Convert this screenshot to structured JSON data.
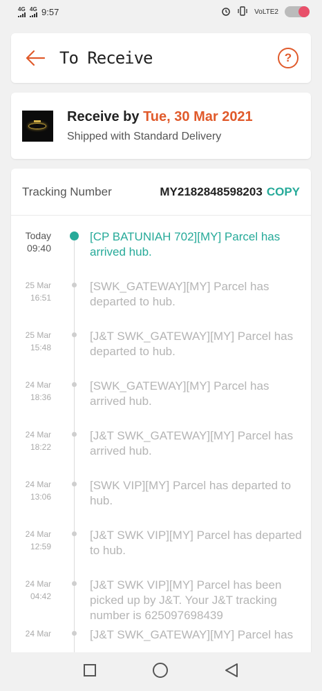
{
  "status_bar": {
    "network1": "4G",
    "network2": "4G",
    "time": "9:57",
    "volte": "VoLTE2"
  },
  "header": {
    "title": "To Receive",
    "help_icon": "question-circle-icon",
    "back_icon": "arrow-left-icon"
  },
  "delivery": {
    "receive_prefix": "Receive by",
    "receive_date": "Tue, 30 Mar 2021",
    "shipping_method": "Shipped with Standard Delivery"
  },
  "tracking": {
    "label": "Tracking Number",
    "number": "MY2182848598203",
    "copy_label": "COPY",
    "events": [
      {
        "date": "Today",
        "time": "09:40",
        "description": "[CP BATUNIAH 702][MY] Parcel has arrived hub.",
        "active": true
      },
      {
        "date": "25 Mar",
        "time": "16:51",
        "description": "[SWK_GATEWAY][MY] Parcel has departed to hub.",
        "active": false
      },
      {
        "date": "25 Mar",
        "time": "15:48",
        "description": "[J&T SWK_GATEWAY][MY] Parcel has departed to hub.",
        "active": false
      },
      {
        "date": "24 Mar",
        "time": "18:36",
        "description": "[SWK_GATEWAY][MY] Parcel has arrived hub.",
        "active": false
      },
      {
        "date": "24 Mar",
        "time": "18:22",
        "description": "[J&T SWK_GATEWAY][MY] Parcel has arrived hub.",
        "active": false
      },
      {
        "date": "24 Mar",
        "time": "13:06",
        "description": "[SWK VIP][MY] Parcel has departed to hub.",
        "active": false
      },
      {
        "date": "24 Mar",
        "time": "12:59",
        "description": "[J&T SWK VIP][MY] Parcel has departed to hub.",
        "active": false
      },
      {
        "date": "24 Mar",
        "time": "04:42",
        "description": "[J&T SWK VIP][MY] Parcel has been picked up by J&T. Your J&T tracking number is 625097698439",
        "active": false
      },
      {
        "date": "24 Mar",
        "time": "",
        "description": "[J&T SWK_GATEWAY][MY] Parcel has",
        "active": false
      }
    ]
  },
  "colors": {
    "accent_orange": "#e05a2b",
    "accent_teal": "#26aa99"
  }
}
